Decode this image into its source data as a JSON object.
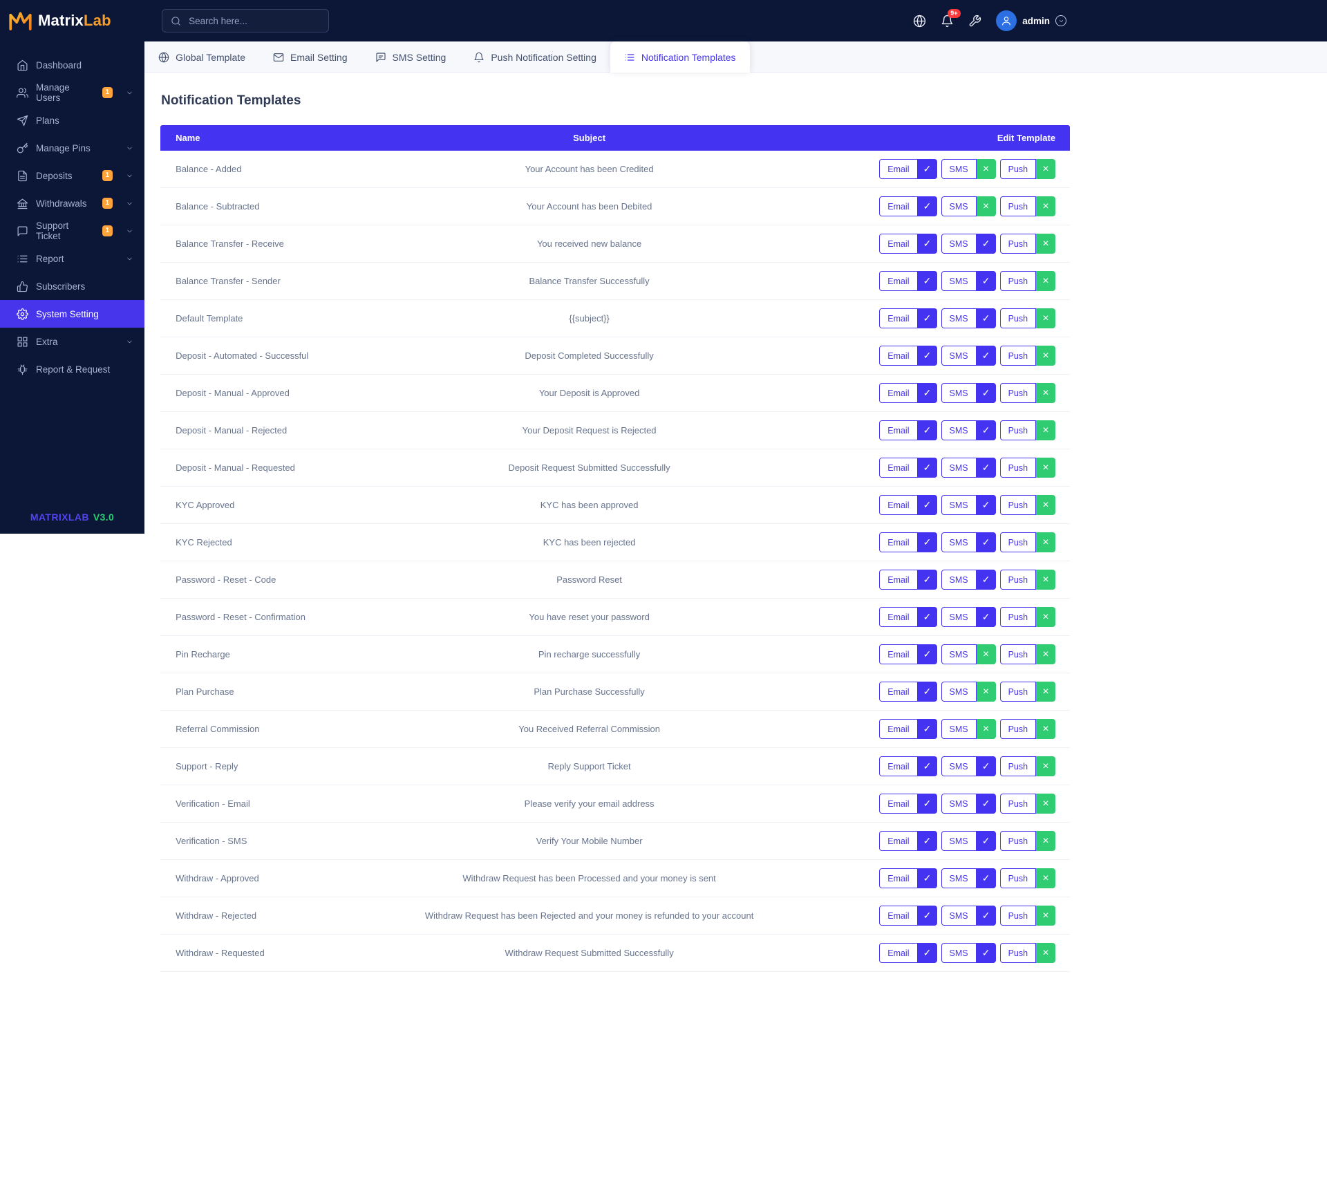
{
  "brand": {
    "name_primary": "Matrix",
    "name_secondary": "Lab",
    "version_brand": "MATRIXLAB",
    "version": "V3.0"
  },
  "topbar": {
    "search_placeholder": "Search here...",
    "notification_count": "9+",
    "username": "admin"
  },
  "sidebar": {
    "items": [
      {
        "label": "Dashboard",
        "icon": "home"
      },
      {
        "label": "Manage Users",
        "icon": "users",
        "badge": "1",
        "expandable": true
      },
      {
        "label": "Plans",
        "icon": "send"
      },
      {
        "label": "Manage Pins",
        "icon": "key",
        "expandable": true
      },
      {
        "label": "Deposits",
        "icon": "file-invoice",
        "badge": "1",
        "expandable": true
      },
      {
        "label": "Withdrawals",
        "icon": "bank",
        "badge": "1",
        "expandable": true
      },
      {
        "label": "Support Ticket",
        "icon": "ticket",
        "badge": "1",
        "expandable": true
      },
      {
        "label": "Report",
        "icon": "report-list",
        "expandable": true
      },
      {
        "label": "Subscribers",
        "icon": "thumbs-up"
      },
      {
        "label": "System Setting",
        "icon": "gear",
        "active": true
      },
      {
        "label": "Extra",
        "icon": "grid",
        "expandable": true
      },
      {
        "label": "Report & Request",
        "icon": "bug"
      }
    ]
  },
  "tabs": [
    {
      "label": "Global Template",
      "icon": "globe",
      "active": false
    },
    {
      "label": "Email Setting",
      "icon": "mail",
      "active": false
    },
    {
      "label": "SMS Setting",
      "icon": "chat",
      "active": false
    },
    {
      "label": "Push Notification Setting",
      "icon": "bell",
      "active": false
    },
    {
      "label": "Notification Templates",
      "icon": "list",
      "active": true
    }
  ],
  "page": {
    "title": "Notification Templates"
  },
  "table": {
    "headers": {
      "name": "Name",
      "subject": "Subject",
      "edit": "Edit Template"
    },
    "buttons": {
      "email": "Email",
      "sms": "SMS",
      "push": "Push"
    },
    "toggle_icons": {
      "on": "✓",
      "off": "×"
    },
    "rows": [
      {
        "name": "Balance - Added",
        "subject": "Your Account has been Credited",
        "email": true,
        "sms": false,
        "push": false
      },
      {
        "name": "Balance - Subtracted",
        "subject": "Your Account has been Debited",
        "email": true,
        "sms": false,
        "push": false
      },
      {
        "name": "Balance Transfer - Receive",
        "subject": "You received new balance",
        "email": true,
        "sms": true,
        "push": false
      },
      {
        "name": "Balance Transfer - Sender",
        "subject": "Balance Transfer Successfully",
        "email": true,
        "sms": true,
        "push": false
      },
      {
        "name": "Default Template",
        "subject": "{{subject}}",
        "email": true,
        "sms": true,
        "push": false
      },
      {
        "name": "Deposit - Automated - Successful",
        "subject": "Deposit Completed Successfully",
        "email": true,
        "sms": true,
        "push": false
      },
      {
        "name": "Deposit - Manual - Approved",
        "subject": "Your Deposit is Approved",
        "email": true,
        "sms": true,
        "push": false
      },
      {
        "name": "Deposit - Manual - Rejected",
        "subject": "Your Deposit Request is Rejected",
        "email": true,
        "sms": true,
        "push": false
      },
      {
        "name": "Deposit - Manual - Requested",
        "subject": "Deposit Request Submitted Successfully",
        "email": true,
        "sms": true,
        "push": false
      },
      {
        "name": "KYC Approved",
        "subject": "KYC has been approved",
        "email": true,
        "sms": true,
        "push": false
      },
      {
        "name": "KYC Rejected",
        "subject": "KYC has been rejected",
        "email": true,
        "sms": true,
        "push": false
      },
      {
        "name": "Password - Reset - Code",
        "subject": "Password Reset",
        "email": true,
        "sms": true,
        "push": false
      },
      {
        "name": "Password - Reset - Confirmation",
        "subject": "You have reset your password",
        "email": true,
        "sms": true,
        "push": false
      },
      {
        "name": "Pin Recharge",
        "subject": "Pin recharge successfully",
        "email": true,
        "sms": false,
        "push": false
      },
      {
        "name": "Plan Purchase",
        "subject": "Plan Purchase Successfully",
        "email": true,
        "sms": false,
        "push": false
      },
      {
        "name": "Referral Commission",
        "subject": "You Received Referral Commission",
        "email": true,
        "sms": false,
        "push": false
      },
      {
        "name": "Support - Reply",
        "subject": "Reply Support Ticket",
        "email": true,
        "sms": true,
        "push": false
      },
      {
        "name": "Verification - Email",
        "subject": "Please verify your email address",
        "email": true,
        "sms": true,
        "push": false
      },
      {
        "name": "Verification - SMS",
        "subject": "Verify Your Mobile Number",
        "email": true,
        "sms": true,
        "push": false
      },
      {
        "name": "Withdraw - Approved",
        "subject": "Withdraw Request has been Processed and your money is sent",
        "email": true,
        "sms": true,
        "push": false
      },
      {
        "name": "Withdraw - Rejected",
        "subject": "Withdraw Request has been Rejected and your money is refunded to your account",
        "email": true,
        "sms": true,
        "push": false
      },
      {
        "name": "Withdraw - Requested",
        "subject": "Withdraw Request Submitted Successfully",
        "email": true,
        "sms": true,
        "push": false
      }
    ]
  },
  "colors": {
    "accent": "#4635eb",
    "table_header": "#4433f0",
    "success_green": "#2fcc71",
    "badge_orange": "#ffa33a",
    "navy": "#0c1737",
    "notification_red": "#fb3b3b"
  }
}
